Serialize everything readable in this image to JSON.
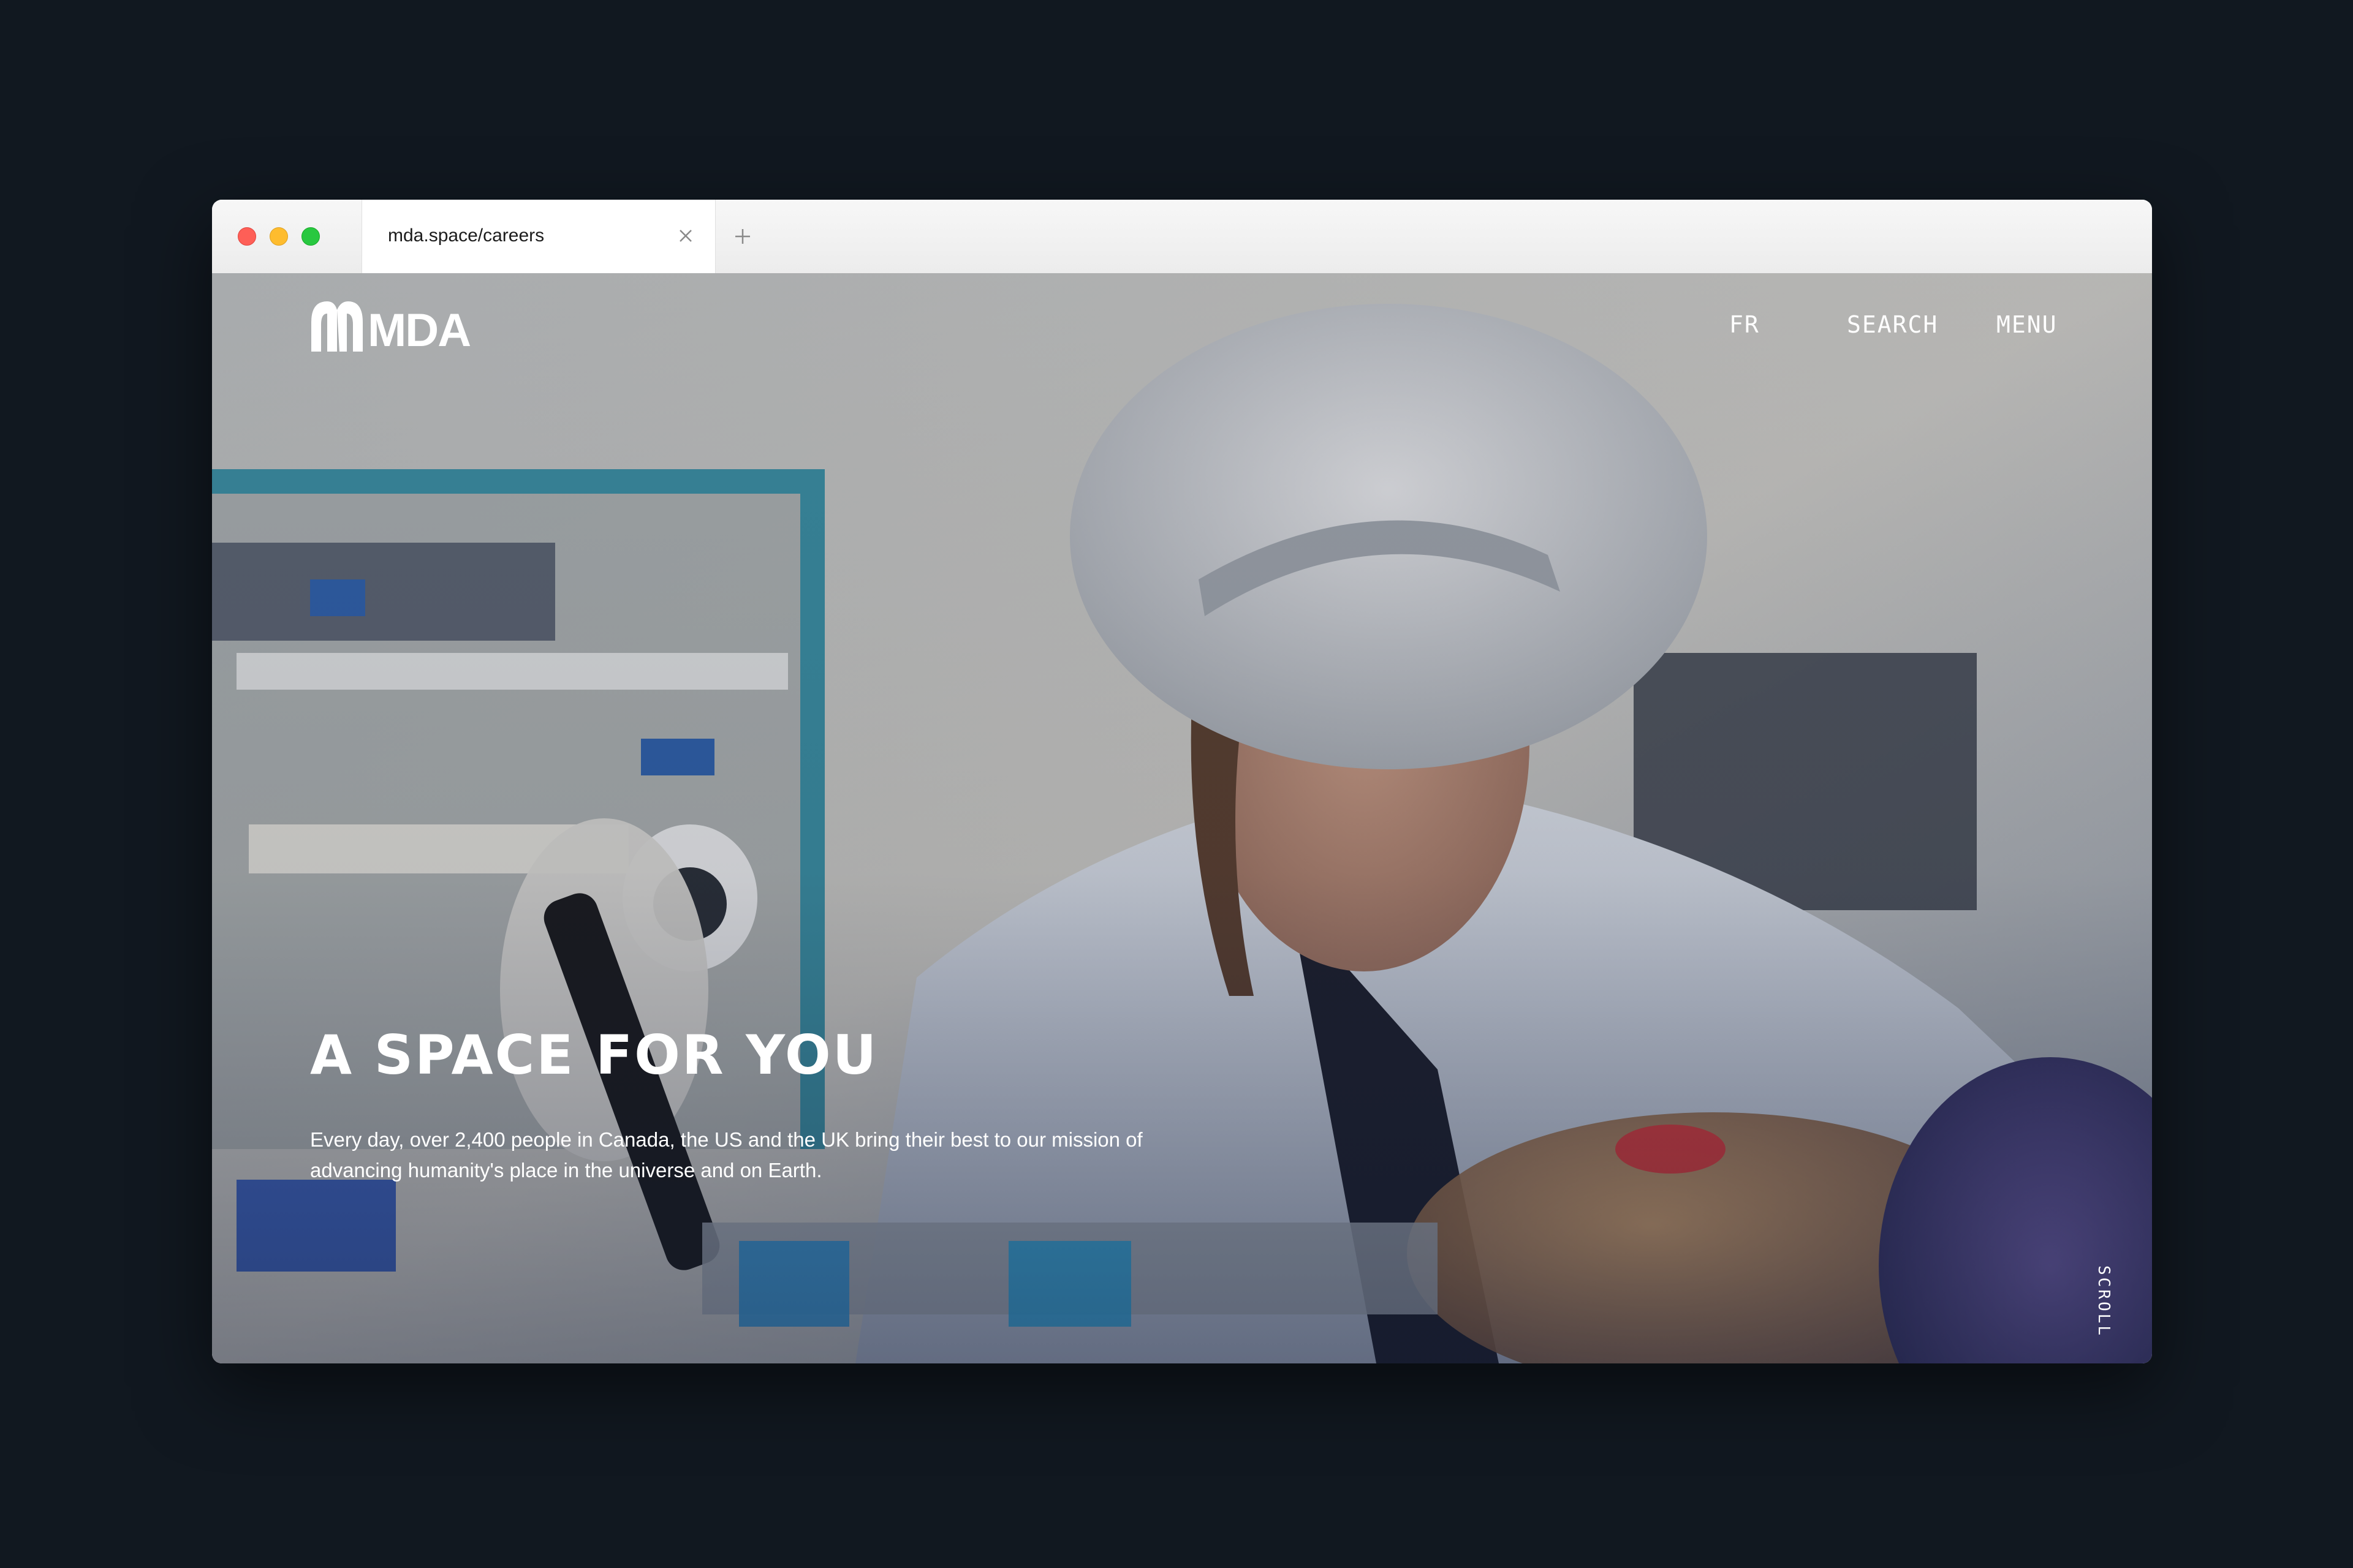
{
  "browser": {
    "tab_url": "mda.space/careers",
    "close_icon": "close-icon",
    "new_tab_icon": "plus-icon"
  },
  "header": {
    "logo_text": "MDA",
    "nav": {
      "fr": "FR",
      "search": "SEARCH",
      "menu": "MENU"
    }
  },
  "hero": {
    "title": "A SPACE FOR YOU",
    "description": "Every day, over 2,400 people in Canada, the US and the UK bring their best to our mission of advancing humanity's place in the universe and on Earth.",
    "scroll_label": "SCROLL"
  },
  "colors": {
    "background": "#111820",
    "text_on_image": "#ffffff",
    "traffic_red": "#fe5f57",
    "traffic_yellow": "#febc2e",
    "traffic_green": "#28c840"
  }
}
